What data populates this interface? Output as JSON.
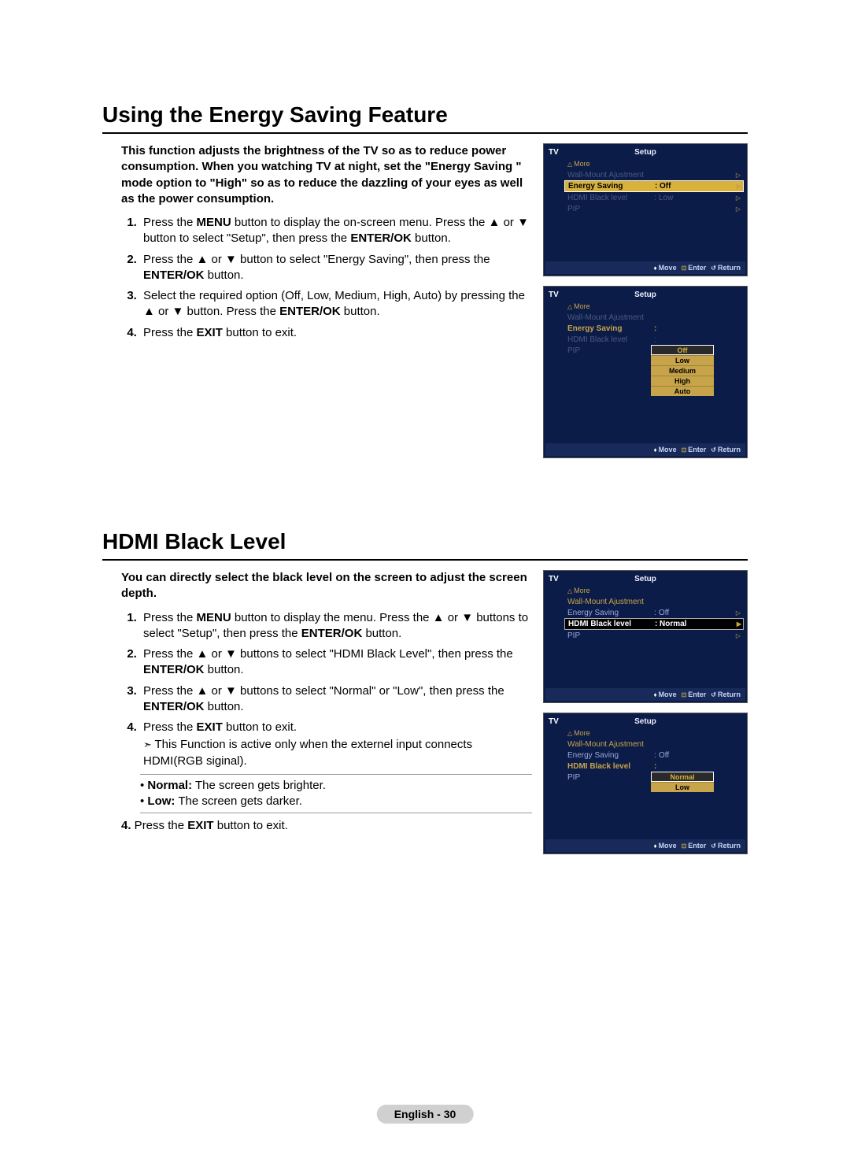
{
  "section1": {
    "heading": "Using the Energy Saving Feature",
    "intro": "This function adjusts the brightness of the TV so as to reduce power consumption. When you watching TV at night, set the \"Energy Saving \" mode option to \"High\" so as to reduce the dazzling of your eyes as well as the power consumption.",
    "step1_a": "Press the ",
    "step1_menu": "MENU",
    "step1_b": " button to display the on-screen menu. Press the ▲ or ▼ button to select \"Setup\", then press the ",
    "step1_enter": "ENTER/OK",
    "step1_c": " button.",
    "step2_a": "Press the ▲ or ▼ button to select \"Energy Saving\", then press the ",
    "step2_enter": "ENTER/OK",
    "step2_b": " button.",
    "step3_a": "Select the required option (Off, Low, Medium, High, Auto) by pressing the ▲ or ▼ button. Press the ",
    "step3_enter": "ENTER/OK",
    "step3_b": " button.",
    "step4_a": "Press the ",
    "step4_exit": "EXIT",
    "step4_b": " button to exit."
  },
  "section2": {
    "heading": "HDMI Black Level",
    "intro": "You can directly select the black level on the screen to adjust the screen depth.",
    "step1_a": "Press the ",
    "step1_menu": "MENU",
    "step1_b": " button to display the menu. Press the ▲ or ▼ buttons to select \"Setup\", then press the ",
    "step1_enter": "ENTER/OK",
    "step1_c": " button.",
    "step2_a": "Press the ▲ or ▼ buttons to select \"HDMI Black Level\", then press the ",
    "step2_enter": "ENTER/OK",
    "step2_b": " button.",
    "step3_a": "Press the ▲ or ▼ buttons to select \"Normal\" or \"Low\", then press the ",
    "step3_enter": "ENTER/OK",
    "step3_b": " button.",
    "step4_a": "Press the ",
    "step4_exit": "EXIT",
    "step4_b": " button to exit.",
    "note": "This Function is active only when the externel input connects HDMI(RGB siginal).",
    "bul_normal_l": "Normal:",
    "bul_normal_t": " The screen gets brighter.",
    "bul_low_l": "Low:",
    "bul_low_t": " The screen gets darker.",
    "post4_num": "4.",
    "post4_a": " Press the ",
    "post4_exit": "EXIT",
    "post4_b": " button to exit."
  },
  "menu": {
    "tv": "TV",
    "setup": "Setup",
    "more": "More",
    "wall": "Wall-Mount Ajustment",
    "energy": "Energy Saving",
    "hdmi": "HDMI Black level",
    "pip": "PIP",
    "off": "Off",
    "low": "Low",
    "medium": "Medium",
    "high": "High",
    "auto": "Auto",
    "normal": "Normal",
    "move": "Move",
    "enter": "Enter",
    "return": "Return",
    "colon": ":"
  },
  "footer": "English - 30"
}
